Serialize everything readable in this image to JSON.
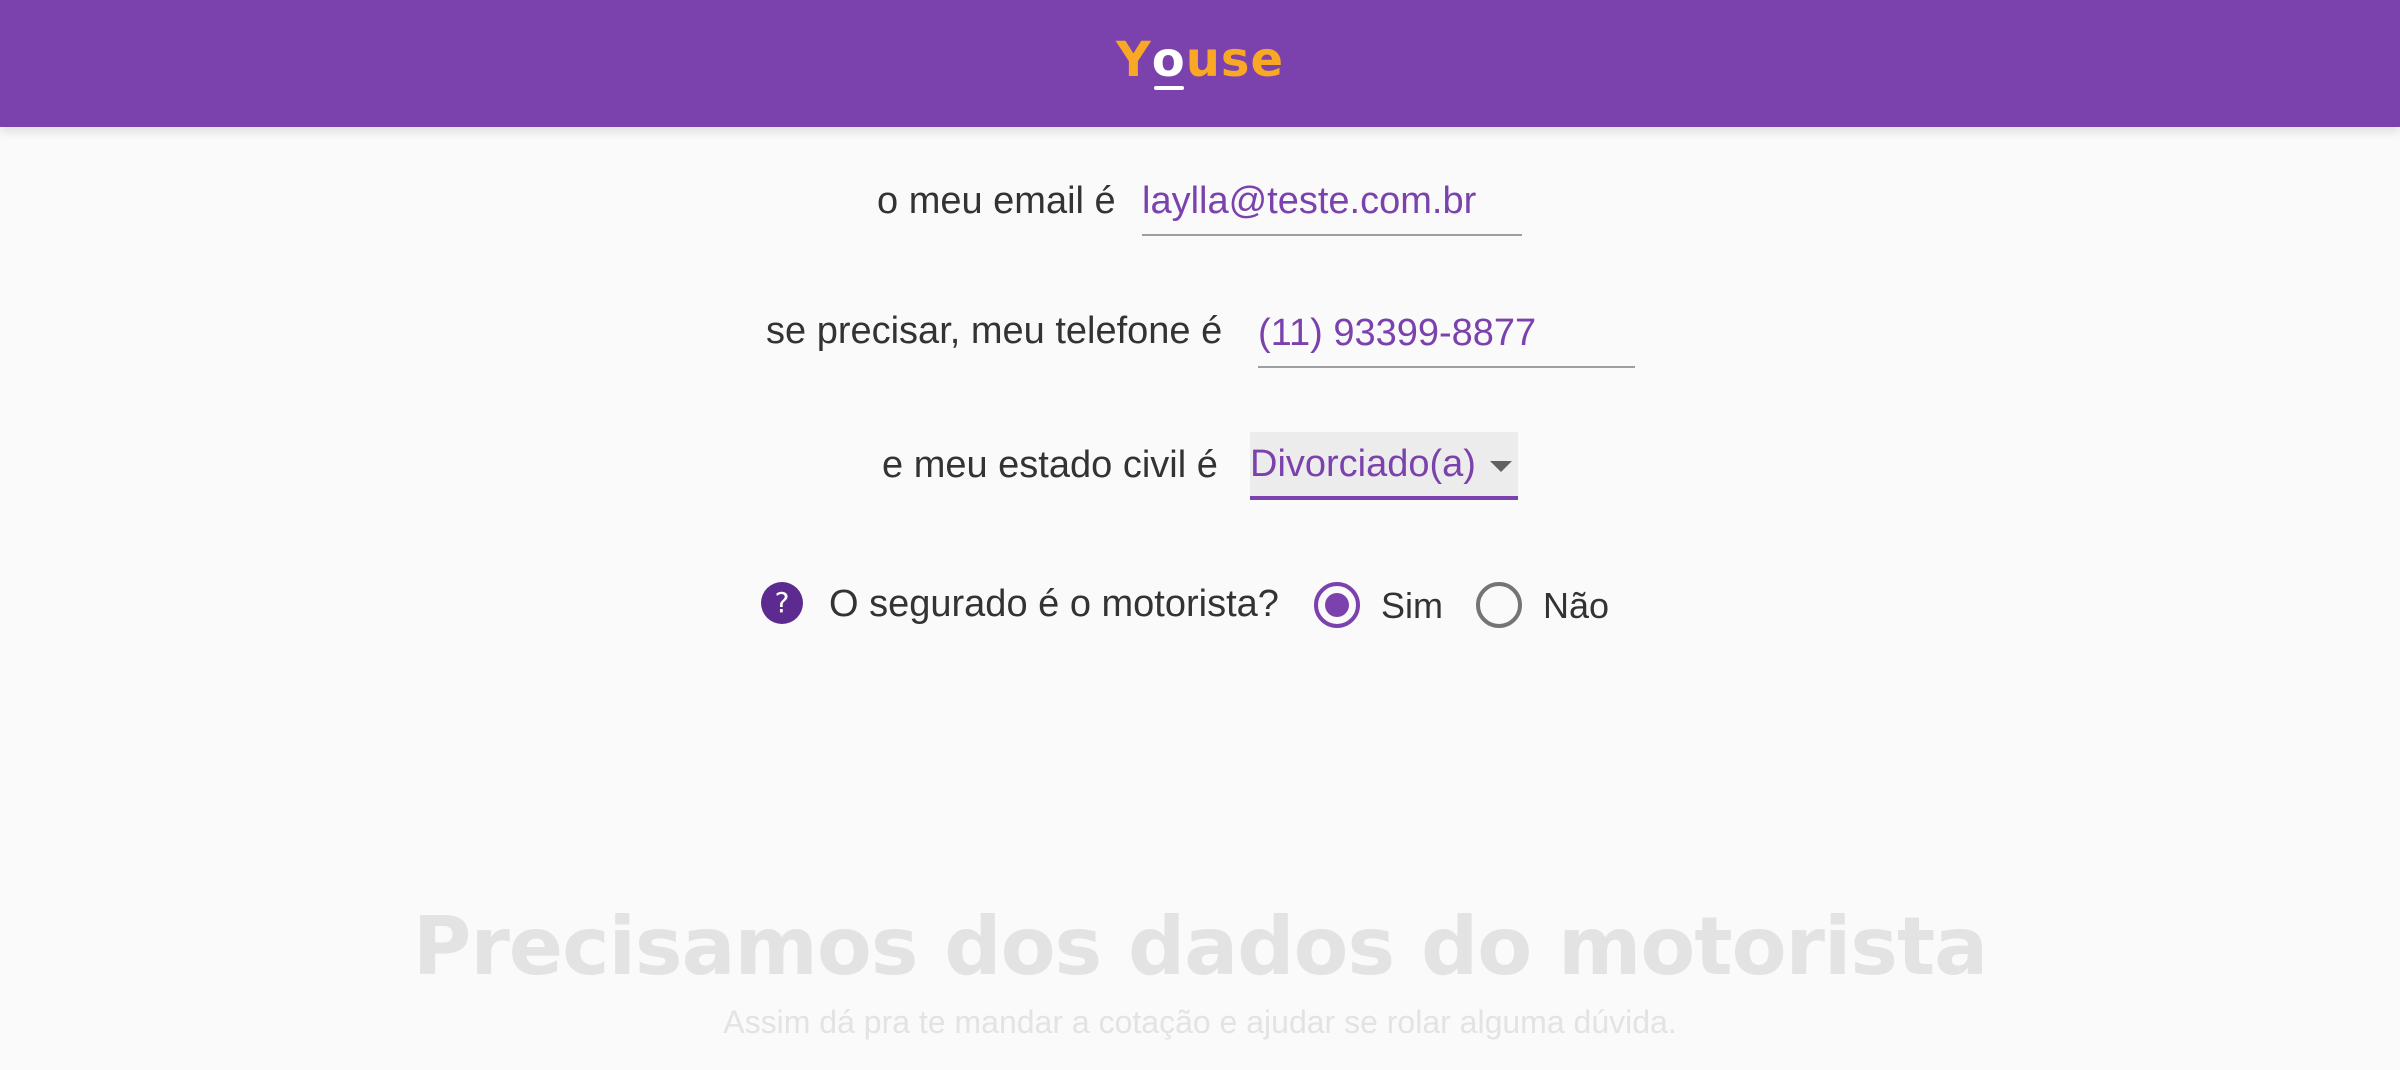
{
  "header": {
    "logo": {
      "y": "Y",
      "o": "o",
      "use": "use",
      "brand_color": "#f9a825",
      "accent_color": "#ffffff",
      "background": "#7b42ad"
    }
  },
  "form": {
    "email": {
      "label": "o meu email é",
      "value": "laylla@teste.com.br"
    },
    "phone": {
      "label": "se precisar, meu telefone é",
      "value": "(11) 93399-8877"
    },
    "civil_status": {
      "label": "e meu estado civil é",
      "selected": "Divorciado(a)",
      "icon": "chevron-down-icon"
    },
    "driver_question": {
      "help_icon": "?",
      "label": "O segurado é o motorista?",
      "options": [
        {
          "label": "Sim",
          "checked": true
        },
        {
          "label": "Não",
          "checked": false
        }
      ]
    }
  },
  "next_section": {
    "title": "Precisamos dos dados do motorista",
    "subtitle": "Assim dá pra te mandar a cotação e ajudar se rolar alguma dúvida."
  },
  "colors": {
    "accent": "#7b42ad",
    "help_icon": "#5d2a8f",
    "text": "#333333",
    "faded_text": "#e3e3e3"
  }
}
